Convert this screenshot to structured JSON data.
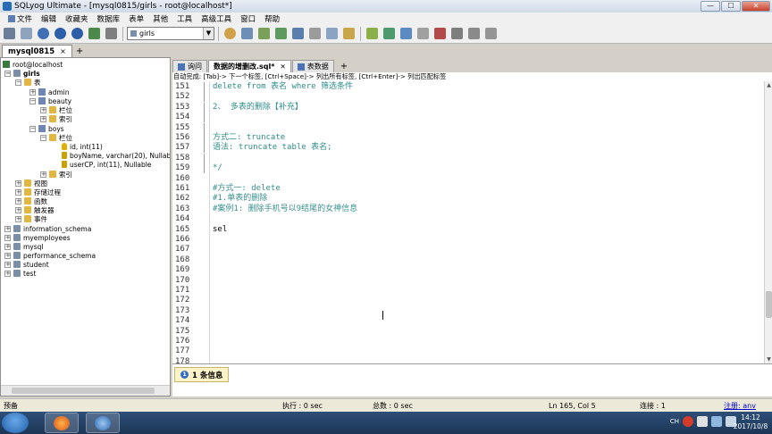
{
  "window": {
    "title": "SQLyog Ultimate - [mysql0815/girls - root@localhost*]",
    "min": "—",
    "max": "☐",
    "close": "✕"
  },
  "menu": [
    "文件",
    "编辑",
    "收藏夹",
    "数据库",
    "表单",
    "其他",
    "工具",
    "高级工具",
    "窗口",
    "帮助"
  ],
  "toolbar": {
    "db_selected": "girls"
  },
  "connection_tab": {
    "label": "mysql0815",
    "close": "×",
    "add": "+"
  },
  "tree": {
    "root": "root@localhost",
    "db_girls": "girls",
    "tables_folder": "表",
    "table_admin": "admin",
    "table_beauty": "beauty",
    "beauty_cols": "栏位",
    "beauty_idx": "索引",
    "table_boys": "boys",
    "boys_cols": "栏位",
    "col_id": "id, int(11)",
    "col_boyname": "boyName, varchar(20), Nullable",
    "col_usercp": "userCP, int(11), Nullable",
    "boys_idx": "索引",
    "views": "视图",
    "procs": "存储过程",
    "funcs": "函数",
    "triggers": "触发器",
    "events": "事件",
    "dbs": [
      "information_schema",
      "myemployees",
      "mysql",
      "performance_schema",
      "student",
      "test"
    ]
  },
  "query_tabs": [
    {
      "label": "询问",
      "active": false
    },
    {
      "label": "数据的增删改.sql*",
      "active": true
    },
    {
      "label": "表数据",
      "active": false
    }
  ],
  "query_add": "+",
  "autocomplete_hint": "自动完成: [Tab]-> 下一个标签, [Ctrl+Space]-> 列出所有标签, [Ctrl+Enter]-> 列出匹配标签",
  "editor": {
    "lines": [
      {
        "n": "151",
        "text": "delete from 表名 where 筛选条件",
        "cls": "c-green"
      },
      {
        "n": "152",
        "text": "",
        "cls": "c-black"
      },
      {
        "n": "153",
        "text": "2、 多表的删除【补充】",
        "cls": "c-green"
      },
      {
        "n": "154",
        "text": "",
        "cls": "c-black"
      },
      {
        "n": "155",
        "text": "",
        "cls": "c-black"
      },
      {
        "n": "156",
        "text": "方式二: truncate",
        "cls": "c-green"
      },
      {
        "n": "157",
        "text": "语法: truncate table 表名;",
        "cls": "c-green"
      },
      {
        "n": "158",
        "text": "",
        "cls": "c-black"
      },
      {
        "n": "159",
        "text": "*/",
        "cls": "c-green"
      },
      {
        "n": "160",
        "text": "",
        "cls": "c-black"
      },
      {
        "n": "161",
        "text": "#方式一: delete",
        "cls": "c-cmt"
      },
      {
        "n": "162",
        "text": "#1.单表的删除",
        "cls": "c-cmt"
      },
      {
        "n": "163",
        "text": "#案例1: 删除手机号以9结尾的女神信息",
        "cls": "c-cmt"
      },
      {
        "n": "164",
        "text": "",
        "cls": "c-black"
      },
      {
        "n": "165",
        "text": "sel",
        "cls": "c-black"
      },
      {
        "n": "166",
        "text": "",
        "cls": "c-black"
      },
      {
        "n": "167",
        "text": "",
        "cls": "c-black"
      },
      {
        "n": "168",
        "text": "",
        "cls": "c-black"
      },
      {
        "n": "169",
        "text": "",
        "cls": "c-black"
      },
      {
        "n": "170",
        "text": "",
        "cls": "c-black"
      },
      {
        "n": "171",
        "text": "",
        "cls": "c-black"
      },
      {
        "n": "172",
        "text": "",
        "cls": "c-black"
      },
      {
        "n": "173",
        "text": "",
        "cls": "c-black"
      },
      {
        "n": "174",
        "text": "",
        "cls": "c-black"
      },
      {
        "n": "175",
        "text": "",
        "cls": "c-black"
      },
      {
        "n": "176",
        "text": "",
        "cls": "c-black"
      },
      {
        "n": "177",
        "text": "",
        "cls": "c-black"
      },
      {
        "n": "178",
        "text": "",
        "cls": "c-black"
      }
    ]
  },
  "result_tab": {
    "num": "1",
    "label": "1 条信息"
  },
  "status": {
    "left": "预备",
    "exec": "执行 : 0 sec",
    "total": "总数 : 0 sec",
    "pos": "Ln 165, Col 5",
    "conn": "连接 : 1",
    "reg": "注册: anv"
  },
  "taskbar": {
    "lang": "CH",
    "time": "14:12",
    "date": "2017/10/8"
  }
}
